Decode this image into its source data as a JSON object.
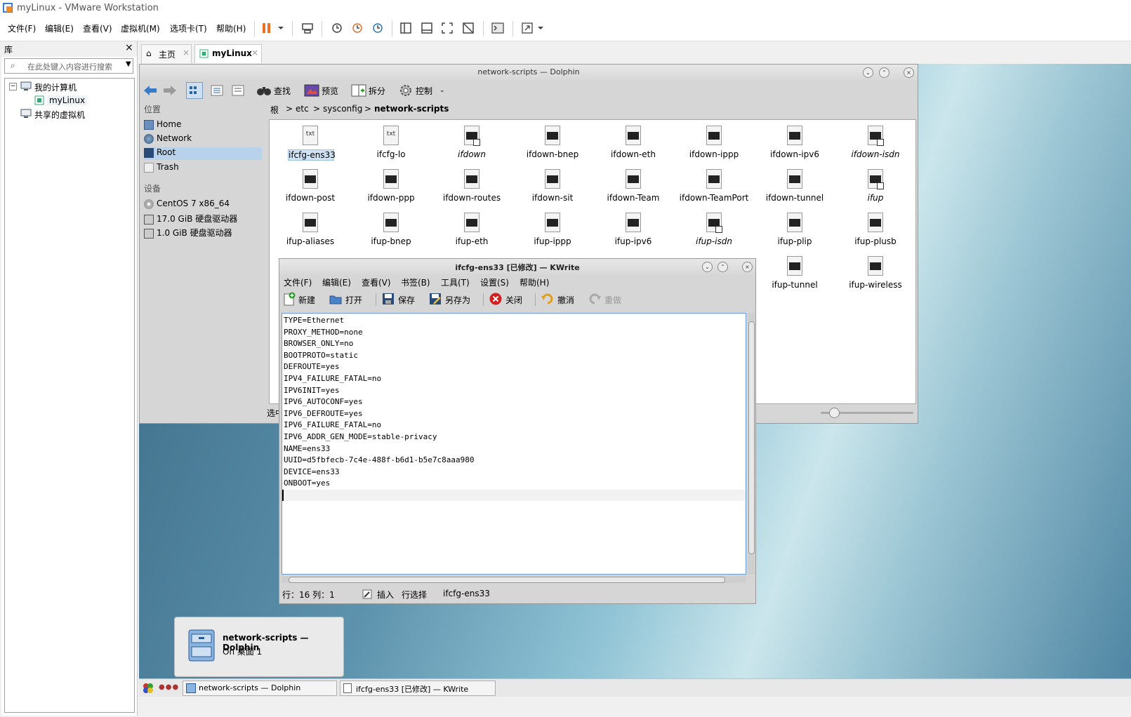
{
  "window": {
    "title": "myLinux - VMware Workstation"
  },
  "menu": [
    "文件(F)",
    "编辑(E)",
    "查看(V)",
    "虚拟机(M)",
    "选项卡(T)",
    "帮助(H)"
  ],
  "library": {
    "title": "库",
    "search_placeholder": "在此处键入内容进行搜索",
    "tree": {
      "root": "我的计算机",
      "vm": "myLinux",
      "shared": "共享的虚拟机"
    }
  },
  "tabs": [
    {
      "label": "主页"
    },
    {
      "label": "myLinux"
    }
  ],
  "dolphin": {
    "title": "network-scripts — Dolphin",
    "toolbar": {
      "find": "查找",
      "preview": "预览",
      "split": "拆分",
      "control": "控制"
    },
    "breadcrumb": [
      "根",
      "etc",
      "sysconfig",
      "network-scripts"
    ],
    "places_title": "位置",
    "places": [
      "Home",
      "Network",
      "Root",
      "Trash"
    ],
    "devices_title": "设备",
    "devices": [
      "CentOS 7 x86_64",
      "17.0 GiB 硬盘驱动器",
      "1.0 GiB 硬盘驱动器"
    ],
    "status_partial": "选中",
    "files": [
      {
        "name": "ifcfg-ens33",
        "kind": "txt",
        "selected": true
      },
      {
        "name": "ifcfg-lo",
        "kind": "txt"
      },
      {
        "name": "ifdown",
        "kind": "link"
      },
      {
        "name": "ifdown-bnep",
        "kind": "script"
      },
      {
        "name": "ifdown-eth",
        "kind": "script"
      },
      {
        "name": "ifdown-ippp",
        "kind": "script"
      },
      {
        "name": "ifdown-ipv6",
        "kind": "script"
      },
      {
        "name": "ifdown-isdn",
        "kind": "link"
      },
      {
        "name": "ifdown-post",
        "kind": "script"
      },
      {
        "name": "ifdown-ppp",
        "kind": "script"
      },
      {
        "name": "ifdown-routes",
        "kind": "script"
      },
      {
        "name": "ifdown-sit",
        "kind": "script"
      },
      {
        "name": "ifdown-Team",
        "kind": "script"
      },
      {
        "name": "ifdown-TeamPort",
        "kind": "script"
      },
      {
        "name": "ifdown-tunnel",
        "kind": "script"
      },
      {
        "name": "ifup",
        "kind": "link"
      },
      {
        "name": "ifup-aliases",
        "kind": "script"
      },
      {
        "name": "ifup-bnep",
        "kind": "script"
      },
      {
        "name": "ifup-eth",
        "kind": "script"
      },
      {
        "name": "ifup-ippp",
        "kind": "script"
      },
      {
        "name": "ifup-ipv6",
        "kind": "script"
      },
      {
        "name": "ifup-isdn",
        "kind": "link"
      },
      {
        "name": "ifup-plip",
        "kind": "script"
      },
      {
        "name": "ifup-plusb",
        "kind": "script"
      },
      {
        "name": "ifup-tunnel",
        "kind": "script"
      },
      {
        "name": "ifup-wireless",
        "kind": "script"
      }
    ]
  },
  "kwrite": {
    "title": "ifcfg-ens33 [已修改] — KWrite",
    "menu": [
      "文件(F)",
      "编辑(E)",
      "查看(V)",
      "书签(B)",
      "工具(T)",
      "设置(S)",
      "帮助(H)"
    ],
    "toolbar": {
      "new": "新建",
      "open": "打开",
      "save": "保存",
      "save_as": "另存为",
      "close": "关闭",
      "undo": "撤消",
      "redo": "重做"
    },
    "lines": [
      "TYPE=Ethernet",
      "PROXY_METHOD=none",
      "BROWSER_ONLY=no",
      "BOOTPROTO=static",
      "DEFROUTE=yes",
      "IPV4_FAILURE_FATAL=no",
      "IPV6INIT=yes",
      "IPV6_AUTOCONF=yes",
      "IPV6_DEFROUTE=yes",
      "IPV6_FAILURE_FATAL=no",
      "IPV6_ADDR_GEN_MODE=stable-privacy",
      "NAME=ens33",
      "UUID=d5fbfecb-7c4e-488f-b6d1-b5e7c8aaa980",
      "DEVICE=ens33",
      "ONBOOT=yes",
      ""
    ],
    "status": {
      "position": "行：16 列：1",
      "mode": "插入",
      "selection": "行选择",
      "file": "ifcfg-ens33"
    }
  },
  "notification": {
    "title": "network-scripts — Dolphin",
    "subtitle": "On 桌面 1"
  },
  "taskbar": {
    "items": [
      "network-scripts — Dolphin",
      "ifcfg-ens33 [已修改] — KWrite"
    ]
  }
}
